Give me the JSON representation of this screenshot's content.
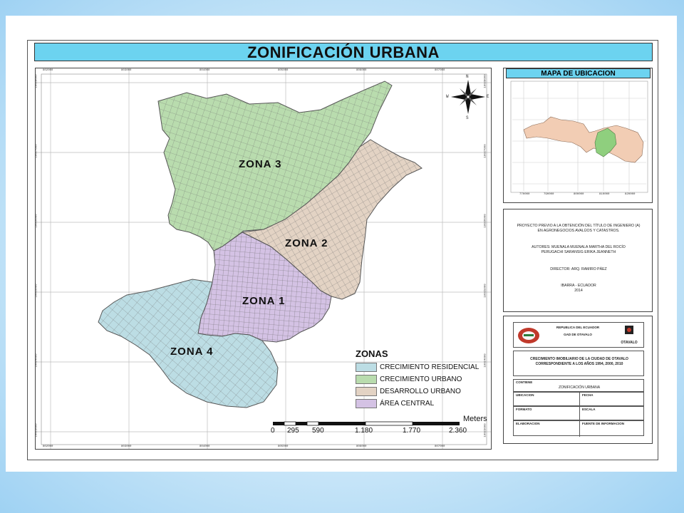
{
  "title": "ZONIFICACIÓN URBANA",
  "map": {
    "top_ticks": [
      "802000",
      "803000",
      "804000",
      "805000",
      "806000",
      "807000"
    ],
    "left_ticks": [
      "10028000",
      "10027000",
      "10026000",
      "10025000",
      "10024000",
      "10023000"
    ],
    "zones": [
      {
        "label": "ZONA  3",
        "color": "#b9dcae"
      },
      {
        "label": "ZONA  2",
        "color": "#e3d3c4"
      },
      {
        "label": "ZONA  1",
        "color": "#d4c2e4"
      },
      {
        "label": "ZONA  4",
        "color": "#bcdde4"
      }
    ],
    "compass": {
      "n": "N",
      "s": "S",
      "e": "E",
      "w": "W"
    }
  },
  "legend": {
    "title": "ZONAS",
    "items": [
      {
        "label": "CRECIMIENTO RESIDENCIAL",
        "color": "#bcdde4"
      },
      {
        "label": "CRECIMIENTO URBANO",
        "color": "#b9dcae"
      },
      {
        "label": "DESARROLLO URBANO",
        "color": "#e3d3c4"
      },
      {
        "label": "ÁREA CENTRAL",
        "color": "#d4c2e4"
      }
    ]
  },
  "scale": {
    "unit": "Meters",
    "labels": [
      "0",
      "295",
      "590",
      "1.180",
      "1.770",
      "2.360"
    ]
  },
  "inset": {
    "title": "MAPA DE UBICACION",
    "x_ticks": [
      "770000",
      "790000",
      "800000",
      "810000",
      "820000"
    ],
    "region_color": "#f2cdb4",
    "highlight_color": "#8fcf7e"
  },
  "info": {
    "lines": [
      "PROYECTO PREVIO A LA OBTENCIÓN DEL TÍTULO DE INGENIERO (A)",
      "EN AGRONEGOCIOS AVALÚOS Y CATASTROS.",
      "AUTORES: MUENALA MUENALA MARTHA DEL ROCÍO",
      "PERUGACHI SARANSIG ERIKA JEANNETH",
      "DIRECTOR: ARQ. RAMIRO PÁEZ",
      "IBARRA -  ECUADOR",
      "2014"
    ]
  },
  "cartouche": {
    "republica": "REPUBLICA DEL ECUADOR",
    "gad": "GAD DE OTAVALO",
    "logo_text": "OTAVALO",
    "heading": "CRECIMIENTO IMOBILIARIO DE LA CIUDAD DE OTAVALO CORRESPONDIENTE A LOS AÑOS 1994, 2000, 2010",
    "contiene_label": "CONTIENE",
    "contiene_value": "ZONIFICACIÓN URBANA",
    "ubicacion_label": "UBICACION",
    "fecha_label": "FECHA",
    "formato_label": "FORMATO",
    "escala_label": "ESCALA",
    "elaboracion_label": "ELABORACION",
    "fuente_label": "FUENTE DE INFORMACION"
  }
}
